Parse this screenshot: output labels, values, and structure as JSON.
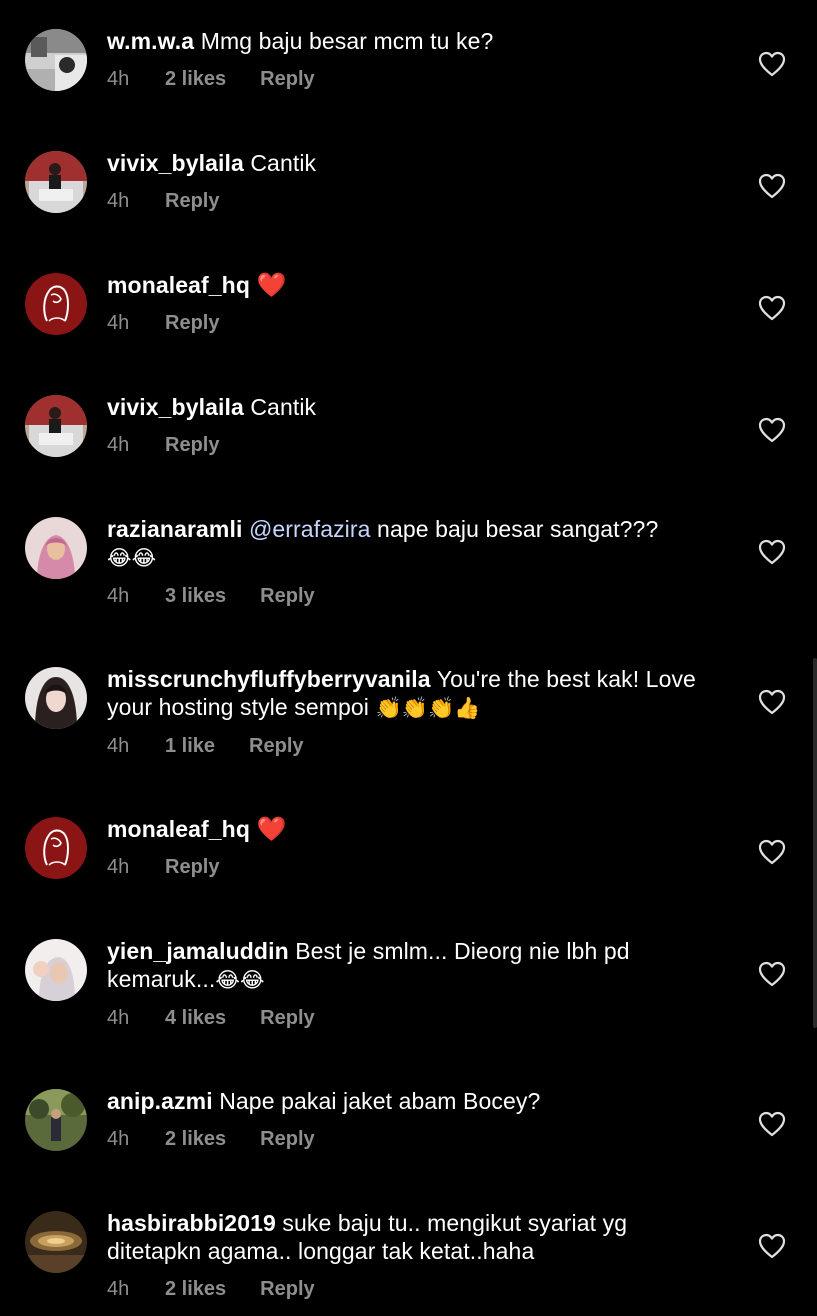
{
  "comments": [
    {
      "username": "w.m.w.a",
      "text": "Mmg baju besar mcm tu ke?",
      "emoji": "",
      "time": "4h",
      "likes": "2 likes",
      "reply": "Reply",
      "avatar_color": "#d8d8d8"
    },
    {
      "username": "vivix_bylaila",
      "text": "Cantik",
      "emoji": "",
      "time": "4h",
      "likes": "",
      "reply": "Reply",
      "avatar_color": "#c9c0b8"
    },
    {
      "username": "monaleaf_hq",
      "text": "",
      "emoji": "❤️",
      "time": "4h",
      "likes": "",
      "reply": "Reply",
      "avatar_color": "#8b1a1a"
    },
    {
      "username": "vivix_bylaila",
      "text": "Cantik",
      "emoji": "",
      "time": "4h",
      "likes": "",
      "reply": "Reply",
      "avatar_color": "#c9c0b8"
    },
    {
      "username": "razianaramli",
      "mention": "@errafazira",
      "text": "nape baju besar sangat???",
      "emoji": "😂😂",
      "time": "4h",
      "likes": "3 likes",
      "reply": "Reply",
      "avatar_color": "#d9a0b0"
    },
    {
      "username": "misscrunchyfluffyberryvanila",
      "text": "You're the best kak! Love your hosting style sempoi",
      "emoji": "👏👏👏👍",
      "time": "4h",
      "likes": "1 like",
      "reply": "Reply",
      "avatar_color": "#d8d2d0"
    },
    {
      "username": "monaleaf_hq",
      "text": "",
      "emoji": "❤️",
      "time": "4h",
      "likes": "",
      "reply": "Reply",
      "avatar_color": "#8b1a1a"
    },
    {
      "username": "yien_jamaluddin",
      "text": "Best je smlm... Dieorg nie lbh pd kemaruk...",
      "emoji": "😂😂",
      "time": "4h",
      "likes": "4 likes",
      "reply": "Reply",
      "avatar_color": "#e6e0e0"
    },
    {
      "username": "anip.azmi",
      "text": "Nape pakai jaket abam Bocey?",
      "emoji": "",
      "time": "4h",
      "likes": "2 likes",
      "reply": "Reply",
      "avatar_color": "#6b7a4a"
    },
    {
      "username": "hasbirabbi2019",
      "text": "suke baju tu.. mengikut syariat yg ditetapkn agama.. longgar tak ketat..haha",
      "emoji": "",
      "time": "4h",
      "likes": "2 likes",
      "reply": "Reply",
      "avatar_color": "#4a3a2a"
    }
  ],
  "icons": {
    "like": "heart-outline-icon",
    "avatar": "profile-photo"
  },
  "colors": {
    "background": "#000000",
    "text": "#ffffff",
    "meta": "#8e8e8e",
    "mention": "#c8d6ff"
  }
}
